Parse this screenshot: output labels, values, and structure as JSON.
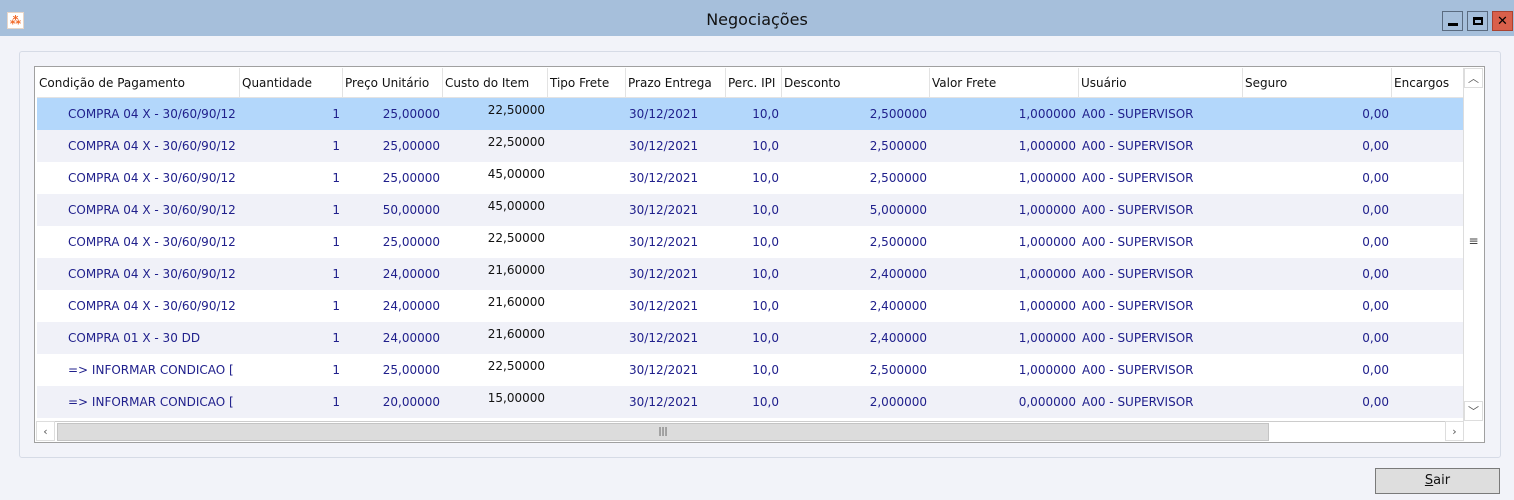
{
  "window": {
    "title": "Negociações",
    "minimize_icon": "minimize-icon",
    "maximize_icon": "maximize-icon",
    "close_icon": "close-icon"
  },
  "grid": {
    "columns": [
      {
        "label": "Condição de Pagamento",
        "key": "cond",
        "align": "l"
      },
      {
        "label": "Quantidade",
        "key": "qtd",
        "align": "r"
      },
      {
        "label": "Preço Unitário",
        "key": "preco",
        "align": "r"
      },
      {
        "label": "Custo do Item",
        "key": "custo",
        "align": "r"
      },
      {
        "label": "Tipo Frete",
        "key": "tipo",
        "align": "l"
      },
      {
        "label": "Prazo Entrega",
        "key": "prazo",
        "align": "l"
      },
      {
        "label": "Perc. IPI",
        "key": "ipi",
        "align": "r"
      },
      {
        "label": "Desconto",
        "key": "desc",
        "align": "r"
      },
      {
        "label": "Valor Frete",
        "key": "frete",
        "align": "r"
      },
      {
        "label": "Usuário",
        "key": "user",
        "align": "l"
      },
      {
        "label": "Seguro",
        "key": "seguro",
        "align": "r"
      },
      {
        "label": "Encargos",
        "key": "enc",
        "align": "r"
      }
    ],
    "rows": [
      {
        "cond": "COMPRA 04 X - 30/60/90/12",
        "qtd": "1",
        "preco": "25,00000",
        "custo": "22,50000",
        "tipo": "",
        "prazo": "30/12/2021",
        "ipi": "10,0",
        "desc": "2,500000",
        "frete": "1,000000",
        "user": "A00 - SUPERVISOR",
        "seguro": "0,00",
        "enc": ""
      },
      {
        "cond": "COMPRA 04 X - 30/60/90/12",
        "qtd": "1",
        "preco": "25,00000",
        "custo": "22,50000",
        "tipo": "",
        "prazo": "30/12/2021",
        "ipi": "10,0",
        "desc": "2,500000",
        "frete": "1,000000",
        "user": "A00 - SUPERVISOR",
        "seguro": "0,00",
        "enc": ""
      },
      {
        "cond": "COMPRA 04 X - 30/60/90/12",
        "qtd": "1",
        "preco": "25,00000",
        "custo": "45,00000",
        "tipo": "",
        "prazo": "30/12/2021",
        "ipi": "10,0",
        "desc": "2,500000",
        "frete": "1,000000",
        "user": "A00 - SUPERVISOR",
        "seguro": "0,00",
        "enc": ""
      },
      {
        "cond": "COMPRA 04 X - 30/60/90/12",
        "qtd": "1",
        "preco": "50,00000",
        "custo": "45,00000",
        "tipo": "",
        "prazo": "30/12/2021",
        "ipi": "10,0",
        "desc": "5,000000",
        "frete": "1,000000",
        "user": "A00 - SUPERVISOR",
        "seguro": "0,00",
        "enc": ""
      },
      {
        "cond": "COMPRA 04 X - 30/60/90/12",
        "qtd": "1",
        "preco": "25,00000",
        "custo": "22,50000",
        "tipo": "",
        "prazo": "30/12/2021",
        "ipi": "10,0",
        "desc": "2,500000",
        "frete": "1,000000",
        "user": "A00 - SUPERVISOR",
        "seguro": "0,00",
        "enc": ""
      },
      {
        "cond": "COMPRA 04 X - 30/60/90/12",
        "qtd": "1",
        "preco": "24,00000",
        "custo": "21,60000",
        "tipo": "",
        "prazo": "30/12/2021",
        "ipi": "10,0",
        "desc": "2,400000",
        "frete": "1,000000",
        "user": "A00 - SUPERVISOR",
        "seguro": "0,00",
        "enc": ""
      },
      {
        "cond": "COMPRA 04 X - 30/60/90/12",
        "qtd": "1",
        "preco": "24,00000",
        "custo": "21,60000",
        "tipo": "",
        "prazo": "30/12/2021",
        "ipi": "10,0",
        "desc": "2,400000",
        "frete": "1,000000",
        "user": "A00 - SUPERVISOR",
        "seguro": "0,00",
        "enc": ""
      },
      {
        "cond": "COMPRA 01 X - 30 DD",
        "qtd": "1",
        "preco": "24,00000",
        "custo": "21,60000",
        "tipo": "",
        "prazo": "30/12/2021",
        "ipi": "10,0",
        "desc": "2,400000",
        "frete": "1,000000",
        "user": "A00 - SUPERVISOR",
        "seguro": "0,00",
        "enc": ""
      },
      {
        "cond": "=> INFORMAR CONDICAO [",
        "qtd": "1",
        "preco": "25,00000",
        "custo": "22,50000",
        "tipo": "",
        "prazo": "30/12/2021",
        "ipi": "10,0",
        "desc": "2,500000",
        "frete": "1,000000",
        "user": "A00 - SUPERVISOR",
        "seguro": "0,00",
        "enc": ""
      },
      {
        "cond": "=> INFORMAR CONDICAO [",
        "qtd": "1",
        "preco": "20,00000",
        "custo": "15,00000",
        "tipo": "",
        "prazo": "30/12/2021",
        "ipi": "10,0",
        "desc": "2,000000",
        "frete": "0,000000",
        "user": "A00 - SUPERVISOR",
        "seguro": "0,00",
        "enc": ""
      }
    ],
    "selected_row": 0
  },
  "buttons": {
    "sair_first": "S",
    "sair_rest": "air"
  }
}
